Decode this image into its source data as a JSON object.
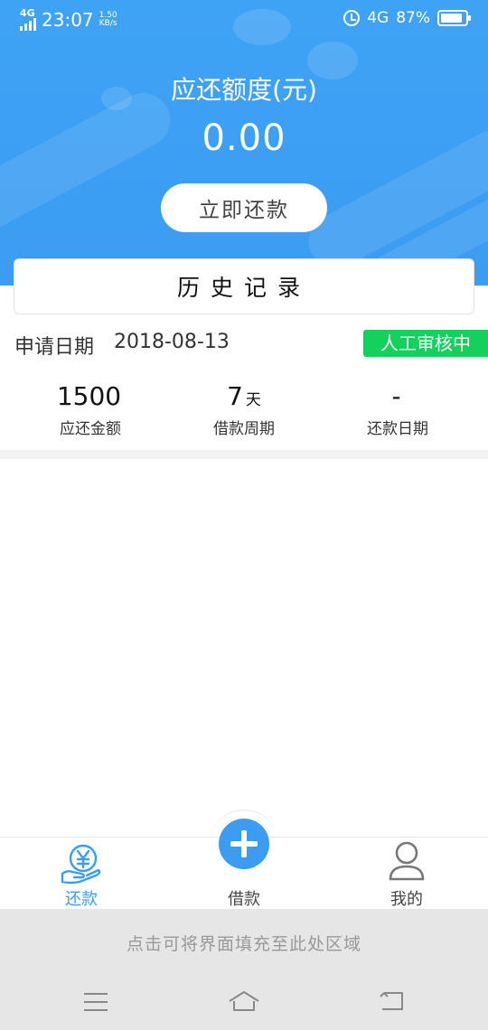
{
  "status_bar": {
    "network_left": "4G",
    "time": "23:07",
    "speed_value": "1.50",
    "speed_unit": "KB/s",
    "network_right": "4G",
    "battery_percent": "87%",
    "battery_level": 0.87
  },
  "header": {
    "title": "应还额度(元)",
    "amount": "0.00",
    "repay_button": "立即还款"
  },
  "history": {
    "title": "历史记录"
  },
  "application": {
    "date_label": "申请日期",
    "date_value": "2018-08-13",
    "status": "人工审核中"
  },
  "stats": [
    {
      "value": "1500",
      "unit": "",
      "label": "应还金额"
    },
    {
      "value": "7",
      "unit": "天",
      "label": "借款周期"
    },
    {
      "value": "-",
      "unit": "",
      "label": "还款日期"
    }
  ],
  "tabs": [
    {
      "label": "还款",
      "icon": "yen-hand-icon",
      "active": true
    },
    {
      "label": "借款",
      "icon": "plus-icon",
      "active": false
    },
    {
      "label": "我的",
      "icon": "user-icon",
      "active": false
    }
  ],
  "fill_area": {
    "text": "点击可将界面填充至此处区域"
  },
  "colors": {
    "primary": "#3b9cf2",
    "badge_green": "#13d15b",
    "divider": "#f3f2f4"
  }
}
